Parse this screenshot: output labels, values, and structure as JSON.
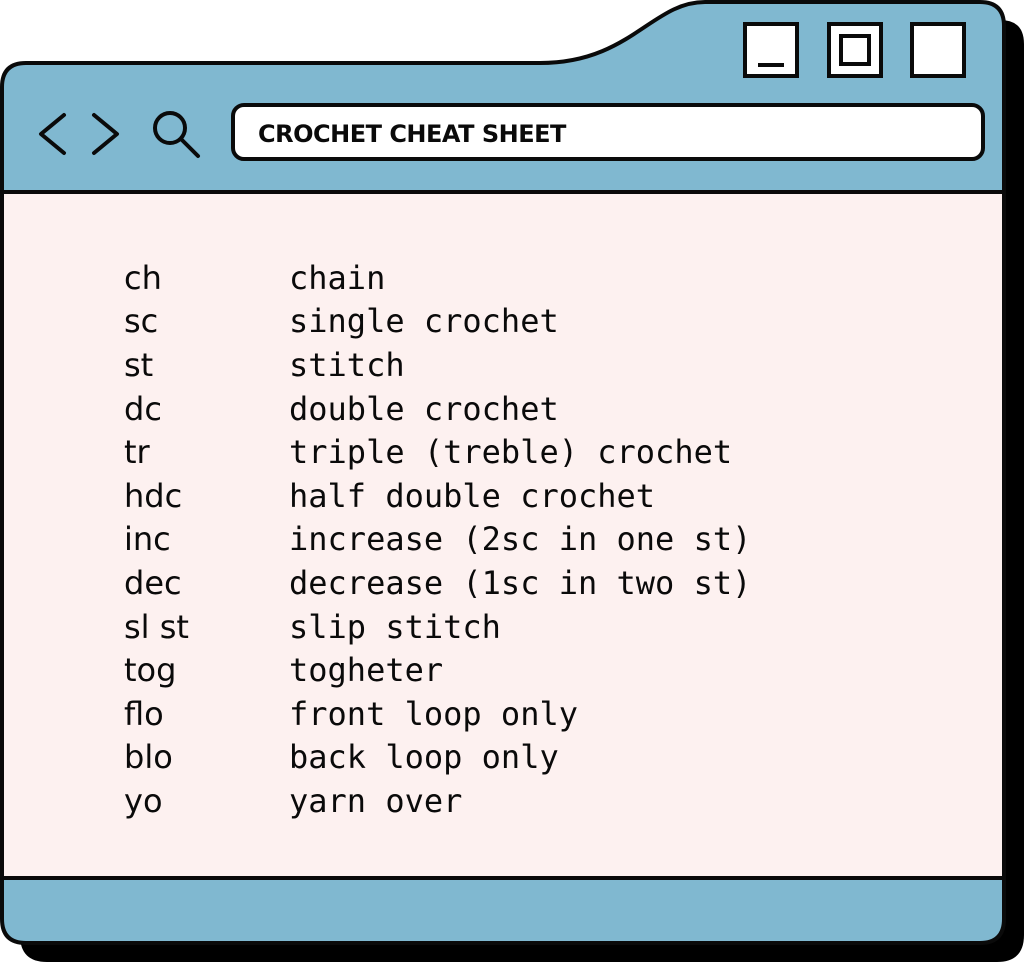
{
  "window": {
    "address_bar": "CROCHET CHEAT SHEET",
    "controls": [
      "minimize",
      "maximize",
      "close"
    ]
  },
  "icons": {
    "back": "chevron-left-icon",
    "forward": "chevron-right-icon",
    "search": "search-icon"
  },
  "colors": {
    "chrome": "#80b8d0",
    "content_bg": "#fdf1f0",
    "outline": "#0a0a0a",
    "shadow": "#000000"
  },
  "glossary": [
    {
      "abbr": "ch",
      "meaning": "chain"
    },
    {
      "abbr": "sc",
      "meaning": "single crochet"
    },
    {
      "abbr": "st",
      "meaning": "stitch"
    },
    {
      "abbr": "dc",
      "meaning": "double crochet"
    },
    {
      "abbr": "tr",
      "meaning": "triple (treble) crochet"
    },
    {
      "abbr": "hdc",
      "meaning": "half double crochet"
    },
    {
      "abbr": "inc",
      "meaning": "increase (2sc in one st)"
    },
    {
      "abbr": "dec",
      "meaning": "decrease (1sc in two st)"
    },
    {
      "abbr": "sl st",
      "meaning": "slip stitch"
    },
    {
      "abbr": "tog",
      "meaning": "togheter"
    },
    {
      "abbr": "flo",
      "meaning": "front loop only"
    },
    {
      "abbr": "blo",
      "meaning": "back loop only"
    },
    {
      "abbr": "yo",
      "meaning": "yarn over"
    }
  ]
}
